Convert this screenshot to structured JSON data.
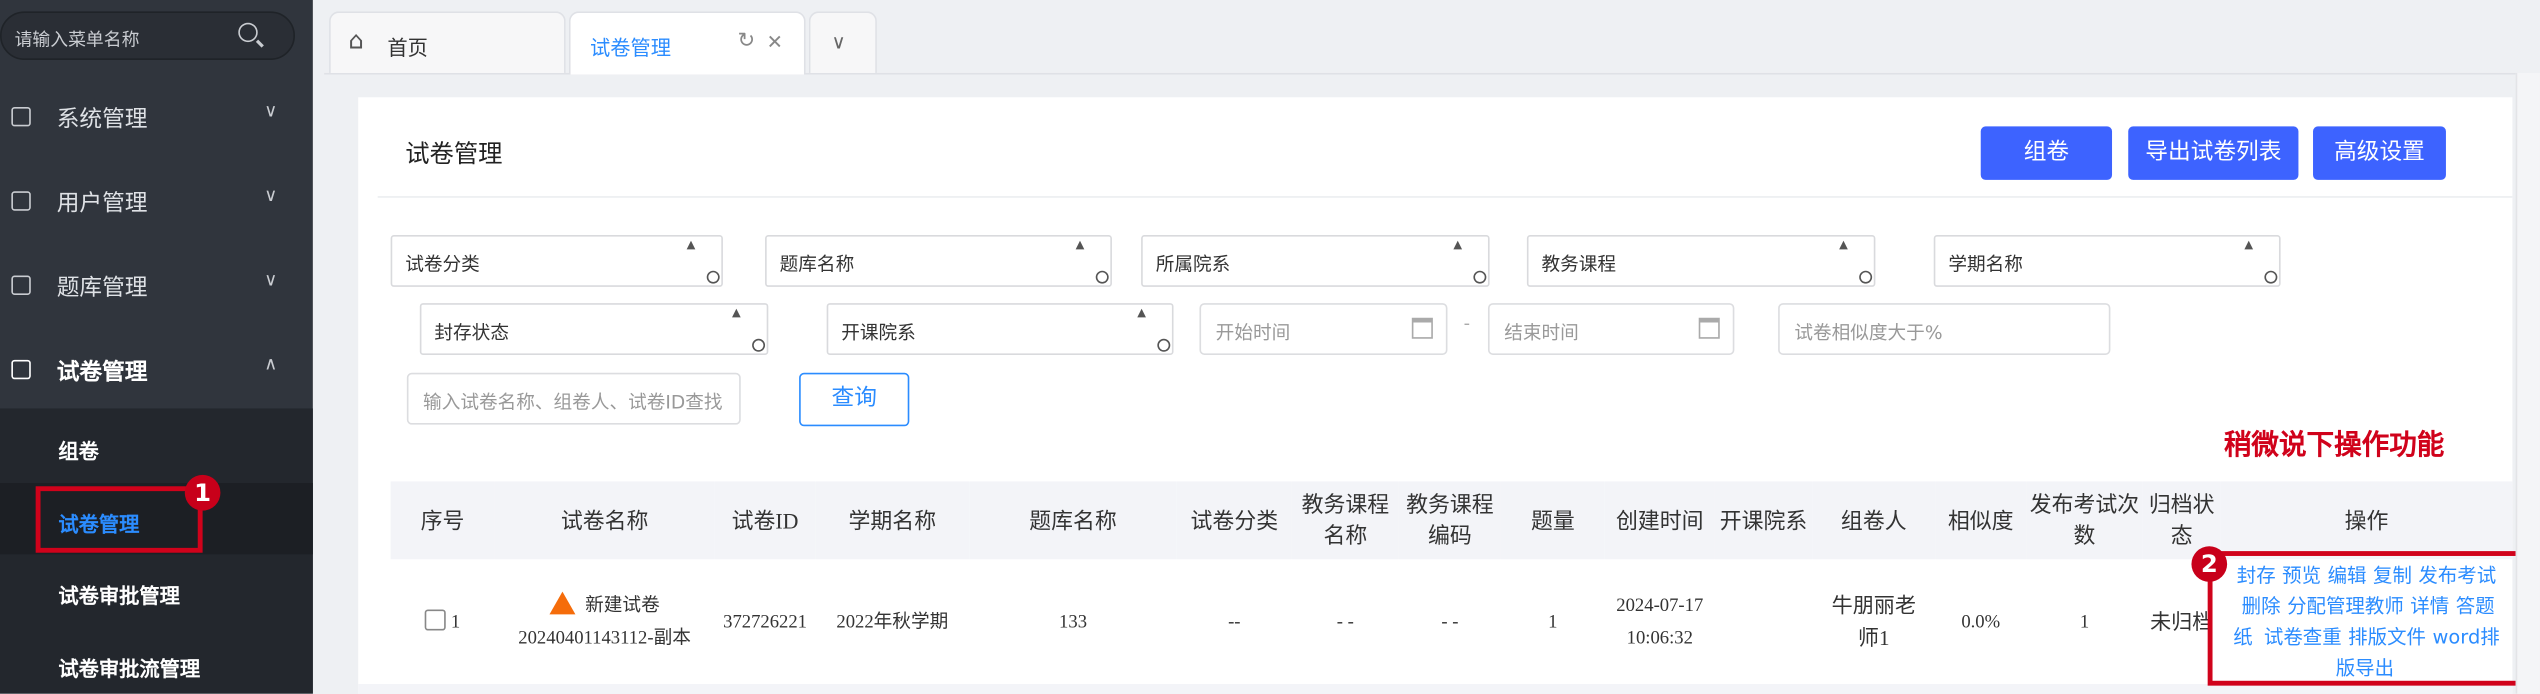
{
  "sidebar": {
    "search_placeholder": "请输入菜单名称",
    "menus": [
      {
        "label": "系统管理",
        "chevron": "∨"
      },
      {
        "label": "用户管理",
        "chevron": "∨"
      },
      {
        "label": "题库管理",
        "chevron": "∨"
      },
      {
        "label": "试卷管理",
        "chevron": "∧"
      }
    ],
    "submenu": [
      {
        "label": "组卷"
      },
      {
        "label": "试卷管理"
      },
      {
        "label": "试卷审批管理"
      },
      {
        "label": "试卷审批流管理"
      }
    ]
  },
  "tabs": [
    {
      "label": "首页"
    },
    {
      "label": "试卷管理"
    }
  ],
  "tab_icons": {
    "home": "⌂",
    "refresh": "↻",
    "close": "✕",
    "more": "∨"
  },
  "page": {
    "title": "试卷管理",
    "buttons": [
      "组卷",
      "导出试卷列表",
      "高级设置"
    ]
  },
  "filters": {
    "selects": [
      "试卷分类",
      "题库名称",
      "所属院系",
      "教务课程",
      "学期名称",
      "封存状态",
      "开课院系"
    ],
    "start_placeholder": "开始时间",
    "end_placeholder": "结束时间",
    "range_sep": "-",
    "similarity_placeholder": "试卷相似度大于%",
    "search_placeholder": "输入试卷名称、组卷人、试卷ID查找",
    "query_label": "查询"
  },
  "annotations": {
    "badge1": "1",
    "badge2": "2",
    "note": "稍微说下操作功能"
  },
  "table": {
    "headers": [
      "序号",
      "试卷名称",
      "试卷ID",
      "学期名称",
      "题库名称",
      "试卷分类",
      "教务课程名称",
      "教务课程编码",
      "题量",
      "创建时间",
      "开课院系",
      "组卷人",
      "相似度",
      "发布考试次数",
      "归档状态",
      "操作"
    ],
    "rows": [
      {
        "index": "1",
        "name_line1": "新建试卷",
        "name_line2": "20240401143112-副本",
        "id": "372726221",
        "term": "2022年秋学期",
        "bank": "133",
        "category": "--",
        "course_name": "- -",
        "course_code": "- -",
        "count": "1",
        "created_date": "2024-07-17",
        "created_time": "10:06:32",
        "dept": "",
        "author": "牛朋丽老师1",
        "similarity": "0.0%",
        "publish_count": "1",
        "archive": "未归档",
        "ops": [
          "封存",
          "预览",
          "编辑",
          "复制",
          "发布考试",
          "删除",
          "分配管理教师",
          "详情",
          "答题纸",
          "试卷查重",
          "排版文件",
          "word排版导出"
        ]
      }
    ]
  }
}
